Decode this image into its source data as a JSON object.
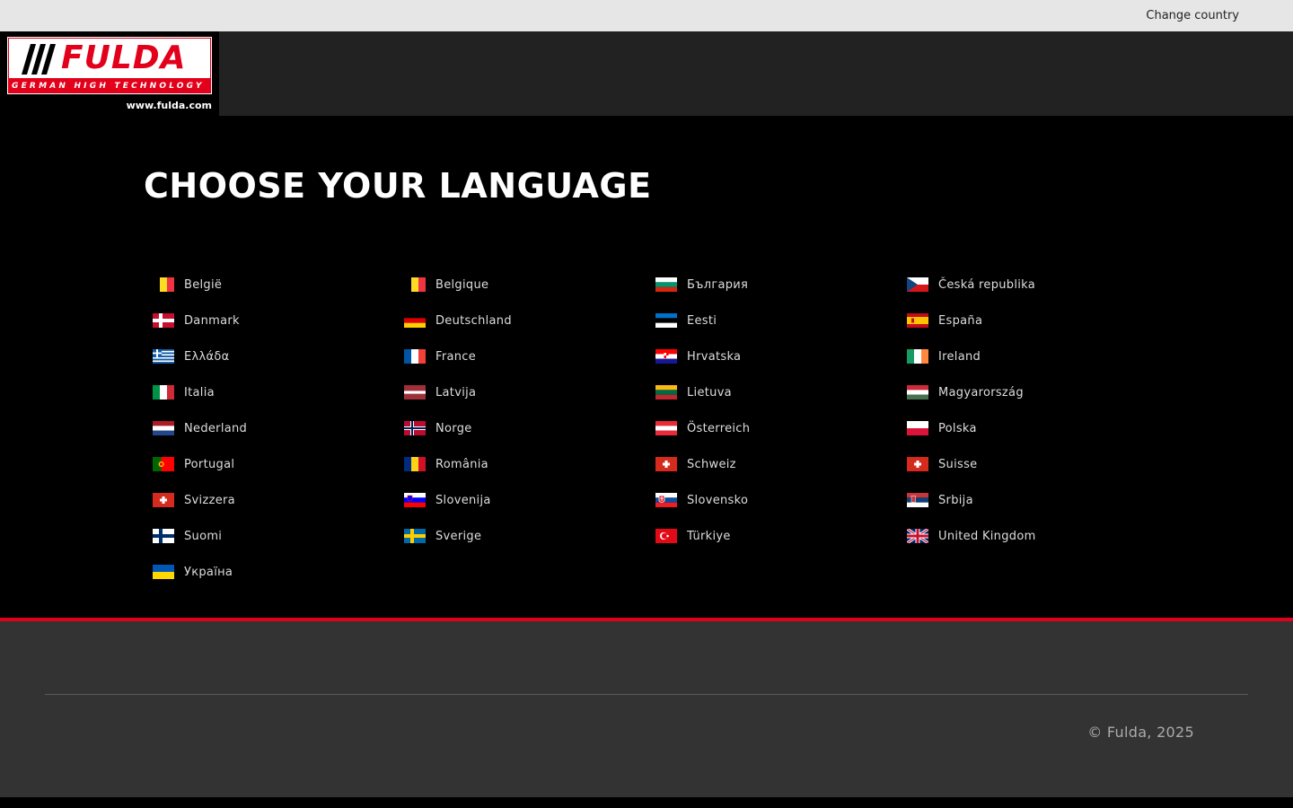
{
  "topbar": {
    "change_country": "Change country"
  },
  "logo": {
    "brand": "FULDA",
    "tagline": "GERMAN HIGH TECHNOLOGY",
    "url": "www.fulda.com",
    "colors": {
      "red": "#e2001a",
      "white": "#ffffff",
      "black": "#000000"
    }
  },
  "main": {
    "title": "CHOOSE YOUR LANGUAGE"
  },
  "languages": [
    {
      "label": "België",
      "flag": "be"
    },
    {
      "label": "Belgique",
      "flag": "be"
    },
    {
      "label": "България",
      "flag": "bg"
    },
    {
      "label": "Česká republika",
      "flag": "cz"
    },
    {
      "label": "Danmark",
      "flag": "dk"
    },
    {
      "label": "Deutschland",
      "flag": "de"
    },
    {
      "label": "Eesti",
      "flag": "ee"
    },
    {
      "label": "España",
      "flag": "es"
    },
    {
      "label": "Ελλάδα",
      "flag": "gr"
    },
    {
      "label": "France",
      "flag": "fr"
    },
    {
      "label": "Hrvatska",
      "flag": "hr"
    },
    {
      "label": "Ireland",
      "flag": "ie"
    },
    {
      "label": "Italia",
      "flag": "it"
    },
    {
      "label": "Latvija",
      "flag": "lv"
    },
    {
      "label": "Lietuva",
      "flag": "lt"
    },
    {
      "label": "Magyarország",
      "flag": "hu"
    },
    {
      "label": "Nederland",
      "flag": "nl"
    },
    {
      "label": "Norge",
      "flag": "no"
    },
    {
      "label": "Österreich",
      "flag": "at"
    },
    {
      "label": "Polska",
      "flag": "pl"
    },
    {
      "label": "Portugal",
      "flag": "pt"
    },
    {
      "label": "România",
      "flag": "ro"
    },
    {
      "label": "Schweiz",
      "flag": "ch"
    },
    {
      "label": "Suisse",
      "flag": "ch"
    },
    {
      "label": "Svizzera",
      "flag": "ch"
    },
    {
      "label": "Slovenija",
      "flag": "si"
    },
    {
      "label": "Slovensko",
      "flag": "sk"
    },
    {
      "label": "Srbija",
      "flag": "rs"
    },
    {
      "label": "Suomi",
      "flag": "fi"
    },
    {
      "label": "Sverige",
      "flag": "se"
    },
    {
      "label": "Türkiye",
      "flag": "tr"
    },
    {
      "label": "United Kingdom",
      "flag": "gb"
    },
    {
      "label": "Україна",
      "flag": "ua"
    }
  ],
  "footer": {
    "copyright": "© Fulda, 2025",
    "accent": "#e2001a"
  }
}
